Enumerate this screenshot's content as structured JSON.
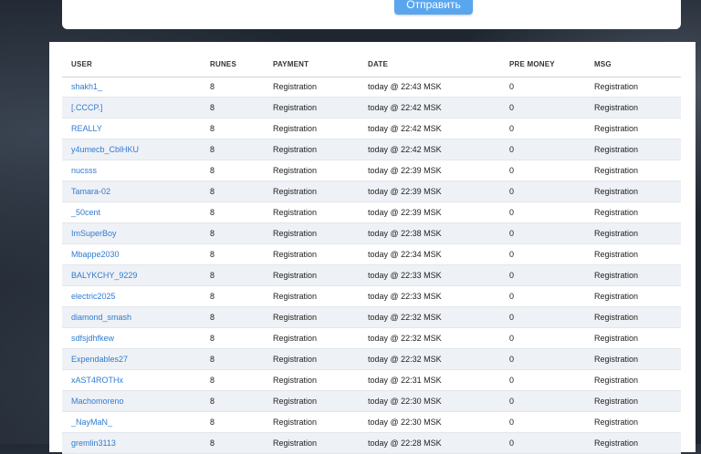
{
  "form": {
    "submit_label": "Отправить"
  },
  "table": {
    "headers": {
      "user": "USER",
      "runes": "RUNES",
      "payment": "PAYMENT",
      "date": "DATE",
      "pre_money": "PRE MONEY",
      "msg": "MSG"
    },
    "rows": [
      {
        "user": "shakh1_",
        "runes": "8",
        "payment": "Registration",
        "date": "today @ 22:43 MSK",
        "pre_money": "0",
        "msg": "Registration"
      },
      {
        "user": "[.CCCP.]",
        "runes": "8",
        "payment": "Registration",
        "date": "today @ 22:42 MSK",
        "pre_money": "0",
        "msg": "Registration"
      },
      {
        "user": "REALLY",
        "runes": "8",
        "payment": "Registration",
        "date": "today @ 22:42 MSK",
        "pre_money": "0",
        "msg": "Registration"
      },
      {
        "user": "y4umecb_CblHKU",
        "runes": "8",
        "payment": "Registration",
        "date": "today @ 22:42 MSK",
        "pre_money": "0",
        "msg": "Registration"
      },
      {
        "user": "nucsss",
        "runes": "8",
        "payment": "Registration",
        "date": "today @ 22:39 MSK",
        "pre_money": "0",
        "msg": "Registration"
      },
      {
        "user": "Tamara-02",
        "runes": "8",
        "payment": "Registration",
        "date": "today @ 22:39 MSK",
        "pre_money": "0",
        "msg": "Registration"
      },
      {
        "user": "_50cent",
        "runes": "8",
        "payment": "Registration",
        "date": "today @ 22:39 MSK",
        "pre_money": "0",
        "msg": "Registration"
      },
      {
        "user": "ImSuperBoy",
        "runes": "8",
        "payment": "Registration",
        "date": "today @ 22:38 MSK",
        "pre_money": "0",
        "msg": "Registration"
      },
      {
        "user": "Mbappe2030",
        "runes": "8",
        "payment": "Registration",
        "date": "today @ 22:34 MSK",
        "pre_money": "0",
        "msg": "Registration"
      },
      {
        "user": "BALYKCHY_9229",
        "runes": "8",
        "payment": "Registration",
        "date": "today @ 22:33 MSK",
        "pre_money": "0",
        "msg": "Registration"
      },
      {
        "user": "electric2025",
        "runes": "8",
        "payment": "Registration",
        "date": "today @ 22:33 MSK",
        "pre_money": "0",
        "msg": "Registration"
      },
      {
        "user": "diamond_smash",
        "runes": "8",
        "payment": "Registration",
        "date": "today @ 22:32 MSK",
        "pre_money": "0",
        "msg": "Registration"
      },
      {
        "user": "sdfsjdhfkew",
        "runes": "8",
        "payment": "Registration",
        "date": "today @ 22:32 MSK",
        "pre_money": "0",
        "msg": "Registration"
      },
      {
        "user": "Expendables27",
        "runes": "8",
        "payment": "Registration",
        "date": "today @ 22:32 MSK",
        "pre_money": "0",
        "msg": "Registration"
      },
      {
        "user": "xAST4ROTHx",
        "runes": "8",
        "payment": "Registration",
        "date": "today @ 22:31 MSK",
        "pre_money": "0",
        "msg": "Registration"
      },
      {
        "user": "Machomoreno",
        "runes": "8",
        "payment": "Registration",
        "date": "today @ 22:30 MSK",
        "pre_money": "0",
        "msg": "Registration"
      },
      {
        "user": "_NayMaN_",
        "runes": "8",
        "payment": "Registration",
        "date": "today @ 22:30 MSK",
        "pre_money": "0",
        "msg": "Registration"
      },
      {
        "user": "gremlin3113",
        "runes": "8",
        "payment": "Registration",
        "date": "today @ 22:28 MSK",
        "pre_money": "0",
        "msg": "Registration"
      }
    ]
  },
  "colors": {
    "accent": "#5aa6ee",
    "link": "#2f7bd1",
    "row_alt": "#eef1f6"
  }
}
